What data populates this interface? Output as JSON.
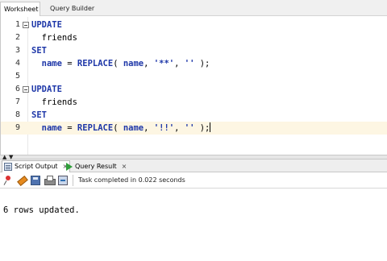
{
  "top_tabs": [
    "Worksheet",
    "Query Builder"
  ],
  "editor": {
    "lines": [
      {
        "num": "1",
        "fold": true,
        "tokens": [
          {
            "t": "UPDATE",
            "c": "kw"
          }
        ]
      },
      {
        "num": "2",
        "fold": false,
        "tokens": [
          {
            "t": "  friends",
            "c": "plain"
          }
        ]
      },
      {
        "num": "3",
        "fold": false,
        "tokens": [
          {
            "t": "SET",
            "c": "kw"
          }
        ]
      },
      {
        "num": "4",
        "fold": false,
        "tokens": [
          {
            "t": "  ",
            "c": "plain"
          },
          {
            "t": "name",
            "c": "id"
          },
          {
            "t": " = ",
            "c": "plain"
          },
          {
            "t": "REPLACE",
            "c": "kw"
          },
          {
            "t": "( ",
            "c": "plain"
          },
          {
            "t": "name",
            "c": "id"
          },
          {
            "t": ", ",
            "c": "plain"
          },
          {
            "t": "'**'",
            "c": "str"
          },
          {
            "t": ", ",
            "c": "plain"
          },
          {
            "t": "''",
            "c": "str"
          },
          {
            "t": " );",
            "c": "plain"
          }
        ]
      },
      {
        "num": "5",
        "fold": false,
        "tokens": []
      },
      {
        "num": "6",
        "fold": true,
        "tokens": [
          {
            "t": "UPDATE",
            "c": "kw"
          }
        ]
      },
      {
        "num": "7",
        "fold": false,
        "tokens": [
          {
            "t": "  friends",
            "c": "plain"
          }
        ]
      },
      {
        "num": "8",
        "fold": false,
        "tokens": [
          {
            "t": "SET",
            "c": "kw"
          }
        ]
      },
      {
        "num": "9",
        "fold": false,
        "current": true,
        "tokens": [
          {
            "t": "  ",
            "c": "plain"
          },
          {
            "t": "name",
            "c": "id"
          },
          {
            "t": " = ",
            "c": "plain"
          },
          {
            "t": "REPLACE",
            "c": "kw"
          },
          {
            "t": "( ",
            "c": "plain"
          },
          {
            "t": "name",
            "c": "id"
          },
          {
            "t": ", ",
            "c": "plain"
          },
          {
            "t": "'!!'",
            "c": "str"
          },
          {
            "t": ", ",
            "c": "plain"
          },
          {
            "t": "''",
            "c": "str"
          },
          {
            "t": " );",
            "c": "plain"
          }
        ]
      }
    ]
  },
  "output_tabs": {
    "script_output": "Script Output",
    "query_result": "Query Result",
    "close": "×"
  },
  "toolbar": {
    "status": "Task completed in 0.022 seconds",
    "icons": [
      "pin-icon",
      "eraser-icon",
      "save-icon",
      "print-icon",
      "export-icon"
    ]
  },
  "output": {
    "text": "6 rows updated."
  },
  "colors": {
    "keyword": "#1e37a8",
    "current_line": "#fdf6e3",
    "run_green": "#2f9e3a"
  }
}
